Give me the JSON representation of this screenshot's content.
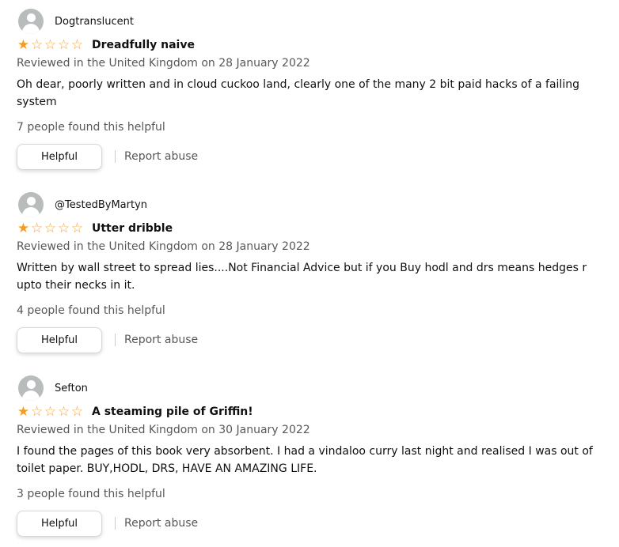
{
  "colors": {
    "star": "#f69c21",
    "muted_text": "#565959",
    "text": "#0f1111"
  },
  "reviews": [
    {
      "reviewer": "Dogtranslucent",
      "rating": 1,
      "max_rating": 5,
      "title": "Dreadfully naive",
      "date": "Reviewed in the United Kingdom on 28 January 2022",
      "body": "Oh dear, poorly written and in cloud cuckoo land, clearly one of the many 2 bit paid hacks of a failing system",
      "helpful_count": "7 people found this helpful",
      "helpful_label": "Helpful",
      "report_label": "Report abuse"
    },
    {
      "reviewer": "@TestedByMartyn",
      "rating": 1,
      "max_rating": 5,
      "title": "Utter dribble",
      "date": "Reviewed in the United Kingdom on 28 January 2022",
      "body": "Written by wall street to spread lies....Not Financial Advice but if you Buy hodl and drs means hedges r upto their necks in it.",
      "helpful_count": "4 people found this helpful",
      "helpful_label": "Helpful",
      "report_label": "Report abuse"
    },
    {
      "reviewer": "Sefton",
      "rating": 1,
      "max_rating": 5,
      "title": "A steaming pile of Griffin!",
      "date": "Reviewed in the United Kingdom on 30 January 2022",
      "body": "I found the pages of this book very absorbent. I had a vindaloo curry last night and realised I was out of toilet paper. BUY,HODL, DRS, HAVE AN AMAZING LIFE.",
      "helpful_count": "3 people found this helpful",
      "helpful_label": "Helpful",
      "report_label": "Report abuse"
    }
  ]
}
